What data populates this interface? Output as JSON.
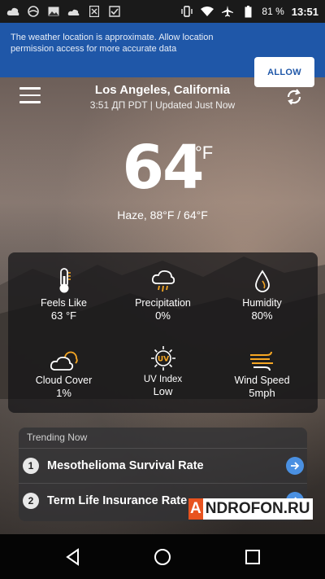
{
  "status_bar": {
    "battery": "81 %",
    "time": "13:51"
  },
  "banner": {
    "message": "The weather location is approximate. Allow location permission access for more accurate data",
    "allow_label": "ALLOW"
  },
  "header": {
    "location": "Los Angeles, California",
    "subtitle": "3:51 ДП PDT | Updated Just Now"
  },
  "current": {
    "temperature": "64",
    "unit": "°F",
    "description": "Haze, 88°F / 64°F"
  },
  "conditions": [
    {
      "label": "Feels Like",
      "value": "63 °F",
      "icon": "thermometer-icon"
    },
    {
      "label": "Precipitation",
      "value": "0%",
      "icon": "rain-cloud-icon"
    },
    {
      "label": "Humidity",
      "value": "80%",
      "icon": "droplet-icon"
    },
    {
      "label": "Cloud Cover",
      "value": "1%",
      "icon": "cloud-sun-icon"
    },
    {
      "label": "UV Index",
      "value": "Low",
      "icon": "uv-sun-icon"
    },
    {
      "label": "Wind Speed",
      "value": "5mph",
      "icon": "wind-icon"
    }
  ],
  "trending": {
    "title": "Trending Now",
    "items": [
      {
        "number": "1",
        "label": "Mesothelioma Survival Rate"
      },
      {
        "number": "2",
        "label": "Term Life Insurance Rate"
      }
    ]
  },
  "watermark": {
    "first": "A",
    "rest": "NDROFON.RU"
  },
  "colors": {
    "banner": "#1f57a8",
    "accent_orange": "#f5a623",
    "arrow_blue": "#4a90e2"
  }
}
